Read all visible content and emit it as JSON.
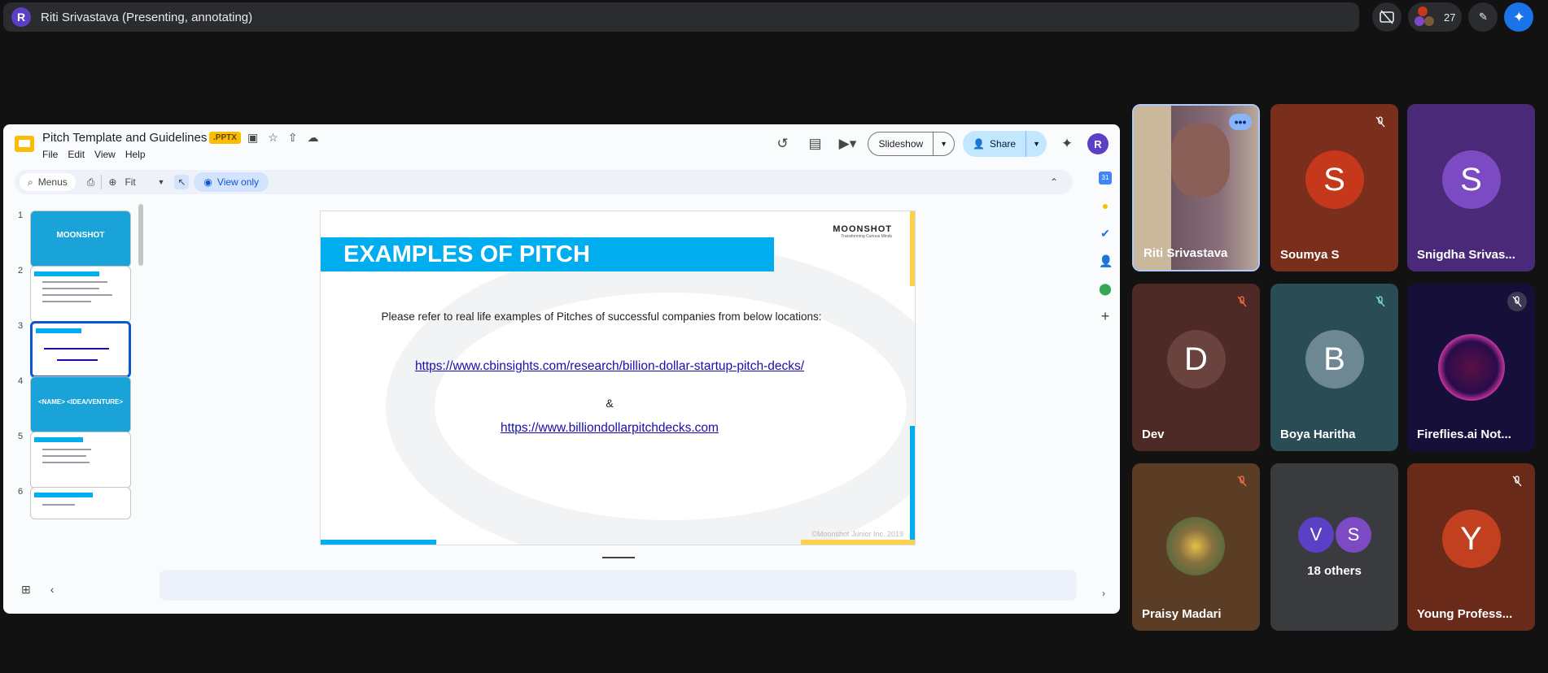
{
  "meet": {
    "presenter_initial": "R",
    "presenter_title": "Riti Srivastava (Presenting, annotating)",
    "participant_count": "27"
  },
  "slides_app": {
    "doc_title": "Pitch Template and Guidelines",
    "badge": ".PPTX",
    "menus": [
      "File",
      "Edit",
      "View",
      "Help"
    ],
    "slideshow_label": "Slideshow",
    "share_label": "Share",
    "user_initial": "R",
    "toolbar": {
      "menus_label": "Menus",
      "zoom_label": "Fit",
      "view_only_label": "View only"
    },
    "thumbnails": [
      {
        "num": "1",
        "text": "MOONSHOT"
      },
      {
        "num": "2",
        "text": ""
      },
      {
        "num": "3",
        "text": ""
      },
      {
        "num": "4",
        "text": "<NAME> <IDEA/VENTURE>"
      },
      {
        "num": "5",
        "text": ""
      },
      {
        "num": "6",
        "text": ""
      }
    ],
    "slide": {
      "heading": "EXAMPLES OF PITCH",
      "logo": "MOONSHOT",
      "logo_tag": "Transforming Curious Minds",
      "intro": "Please refer to real life examples of Pitches of successful companies from below locations:",
      "link1": "https://www.cbinsights.com/research/billion-dollar-startup-pitch-decks/",
      "amp": "&",
      "link2": "https://www.billiondollarpitchdecks.com",
      "copyright": "©Moonshot Junior Inc. 2019"
    }
  },
  "tiles": [
    {
      "name": "Riti Srivastava",
      "initial": "",
      "bg": "#6d5560"
    },
    {
      "name": "Soumya S",
      "initial": "S",
      "bg": "#7a2e1c",
      "circle": "#c5381c"
    },
    {
      "name": "Snigdha Srivas...",
      "initial": "S",
      "bg": "#4a2a78",
      "circle": "#7c4bc4"
    },
    {
      "name": "Dev",
      "initial": "D",
      "bg": "#4e2a26",
      "circle": "#6b433e"
    },
    {
      "name": "Boya Haritha",
      "initial": "B",
      "bg": "#2a4c55",
      "circle": "#6d8892"
    },
    {
      "name": "Fireflies.ai Not...",
      "initial": "",
      "bg": "#150f3a"
    },
    {
      "name": "Praisy Madari",
      "initial": "",
      "bg": "#5a3d24"
    },
    {
      "name": "18 others",
      "initial": "",
      "bg": "#3a3b3e",
      "others": [
        "V",
        "S"
      ]
    },
    {
      "name": "Young Profess...",
      "initial": "Y",
      "bg": "#6a2a1a",
      "circle": "#c2401f"
    }
  ]
}
